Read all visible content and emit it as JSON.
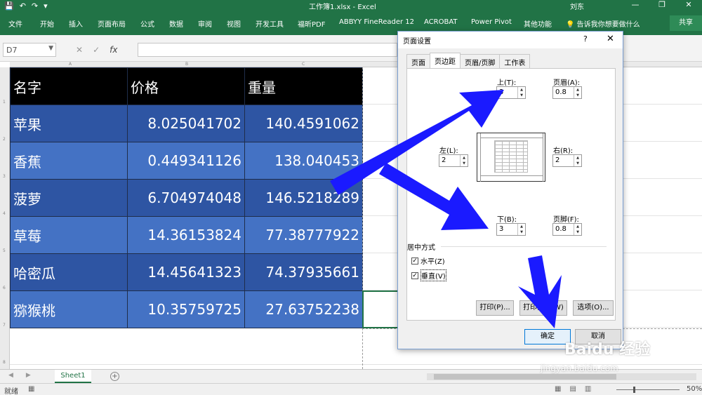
{
  "window": {
    "title": "工作簿1.xlsx  -  Excel",
    "user": "刘东",
    "controls": [
      "—",
      "❐",
      "✕"
    ]
  },
  "qat": {
    "save": "💾",
    "undo": "↶",
    "redo": "↷",
    "customize": "▾"
  },
  "ribbon": {
    "tabs": [
      "文件",
      "开始",
      "插入",
      "页面布局",
      "公式",
      "数据",
      "审阅",
      "视图",
      "开发工具",
      "福昕PDF",
      "ABBYY FineReader 12",
      "ACROBAT",
      "Power Pivot",
      "其他功能"
    ],
    "tell_me": "告诉我你想要做什么",
    "share": "共享"
  },
  "formula_bar": {
    "name_box": "D7",
    "cancel": "✕",
    "enter": "✓",
    "fx": "fx",
    "formula": ""
  },
  "sheet": {
    "columns": [
      "A",
      "B",
      "C"
    ],
    "rows": [
      "1",
      "2",
      "3",
      "4",
      "5",
      "6",
      "7",
      "8"
    ],
    "headers": [
      "名字",
      "价格",
      "重量"
    ],
    "data": [
      [
        "苹果",
        "8.025041702",
        "140.4591062"
      ],
      [
        "香蕉",
        "0.449341126",
        "138.040453"
      ],
      [
        "菠萝",
        "6.704974048",
        "146.5218289"
      ],
      [
        "草莓",
        "14.36153824",
        "77.38777922"
      ],
      [
        "哈密瓜",
        "14.45641323",
        "74.37935661"
      ],
      [
        "猕猴桃",
        "10.35759725",
        "27.63752238"
      ]
    ],
    "colors": {
      "header_bg": "#000000",
      "row_dark": "#2e55a3",
      "row_light": "#4472c4"
    }
  },
  "sheet_tabs": {
    "active": "Sheet1",
    "add": "+",
    "prev": "◀",
    "next": "▶"
  },
  "status": {
    "ready": "就绪",
    "zoom": "50%"
  },
  "dialog": {
    "title": "页面设置",
    "help": "?",
    "close": "✕",
    "tabs": [
      "页面",
      "页边距",
      "页眉/页脚",
      "工作表"
    ],
    "active_tab": "页边距",
    "fields": {
      "top": {
        "label": "上(T):",
        "value": "3"
      },
      "header": {
        "label": "页眉(A):",
        "value": "0.8"
      },
      "left": {
        "label": "左(L):",
        "value": "2"
      },
      "right": {
        "label": "右(R):",
        "value": "2"
      },
      "bottom": {
        "label": "下(B):",
        "value": "3"
      },
      "footer": {
        "label": "页脚(F):",
        "value": "0.8"
      }
    },
    "center_section": "居中方式",
    "horizontal": {
      "label": "水平(Z)",
      "checked": true
    },
    "vertical": {
      "label": "垂直(V)",
      "checked": true
    },
    "buttons": {
      "print": "打印(P)...",
      "preview": "打印预览(W)",
      "options": "选项(O)...",
      "ok": "确定",
      "cancel": "取消"
    }
  },
  "annotation_color": "#1a1aff",
  "watermark": {
    "logo": "Baidu 经验",
    "url": "jingyan.baidu.com"
  }
}
